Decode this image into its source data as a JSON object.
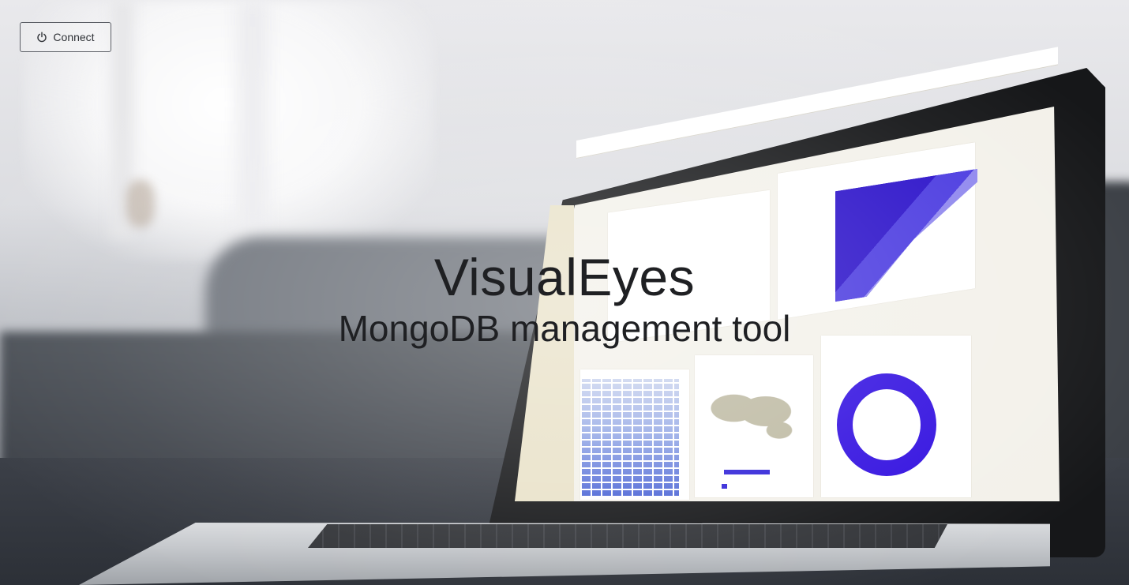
{
  "toolbar": {
    "connect_label": "Connect",
    "connect_icon": "power-icon"
  },
  "hero": {
    "title": "VisualEyes",
    "subtitle": "MongoDB management tool"
  },
  "background": {
    "description_icon": "laptop-analytics-photo",
    "accent_color": "#3210e0"
  }
}
